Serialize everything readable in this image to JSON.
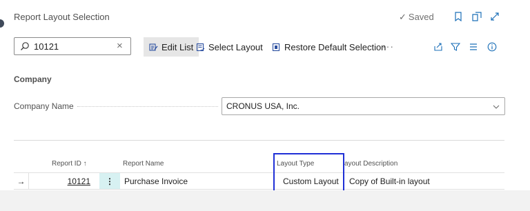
{
  "header": {
    "title": "Report Layout Selection",
    "saved_label": "Saved",
    "saved_icon": "check-icon",
    "icons": [
      "bookmark-icon",
      "open-new-window-icon",
      "expand-icon"
    ]
  },
  "toolbar": {
    "search_value": "10121",
    "buttons": {
      "edit_list": "Edit List",
      "select_layout": "Select Layout",
      "restore_default": "Restore Default Selection"
    },
    "more_label": "···",
    "right_icons": [
      "share-icon",
      "filter-icon",
      "list-view-icon",
      "info-icon"
    ]
  },
  "section": {
    "title": "Company",
    "company_name_label": "Company Name",
    "company_name_value": "CRONUS USA, Inc."
  },
  "table": {
    "headers": {
      "report_id": "Report ID ↑",
      "report_name": "Report Name",
      "layout_type": "Layout Type",
      "layout_description": "ayout Description"
    },
    "rows": [
      {
        "arrow": "→",
        "report_id": "10121",
        "menu": "⋮",
        "report_name": "Purchase Invoice",
        "layout_type": "Custom Layout",
        "layout_description": "Copy of Built-in layout"
      }
    ]
  },
  "colors": {
    "highlight_box": "#1f2fd6",
    "active_cell": "#d7f1f2",
    "active_button": "#e6e6e6",
    "accent": "#3a7f86"
  }
}
